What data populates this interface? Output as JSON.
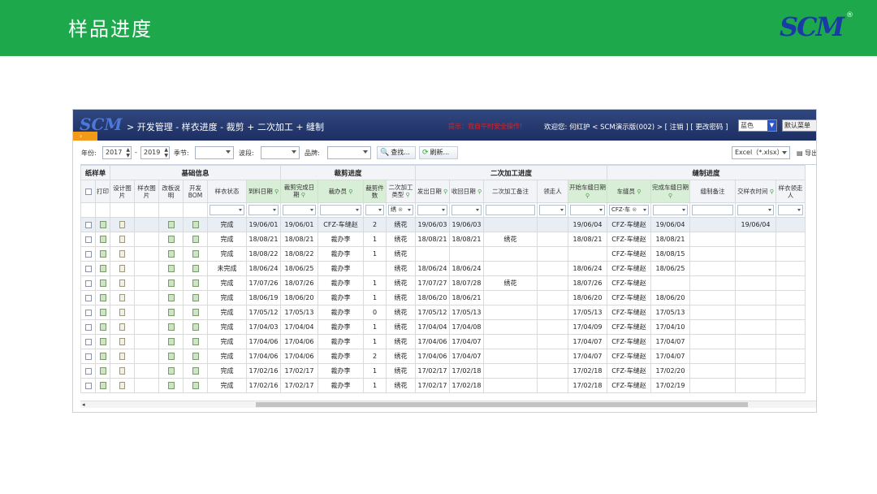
{
  "slide": {
    "title": "样品进度",
    "logo": "SCM"
  },
  "app": {
    "logo": "SCM",
    "breadcrumb": "> 开发管理 - 样衣进度 - 裁剪 + 二次加工 + 缝制",
    "warning": "提示：我自午时安全操作!",
    "user": "欢迎您: 何红护 < SCM演示版(002) > [ 注销 ] [ 更改密码 ]",
    "skin": "蓝色",
    "menu": "默认菜单"
  },
  "toolbar": {
    "year_label": "年份:",
    "year_from": "2017",
    "dash": "-",
    "year_to": "2019",
    "season_label": "季节:",
    "wave_label": "波段:",
    "category_label": "品牌:",
    "find_label": "查找...",
    "refresh_label": "刷新...",
    "excel_label": "Excel（*.xlsx）",
    "export_label": "导出"
  },
  "groups": [
    {
      "label": "纸样单",
      "span": 2
    },
    {
      "label": "基础信息",
      "span": 6
    },
    {
      "label": "裁剪进度",
      "span": 4
    },
    {
      "label": "二次加工进度",
      "span": 5
    },
    {
      "label": "缝制进度",
      "span": 6
    }
  ],
  "columns": [
    "",
    "打印",
    "设计图片",
    "样衣图片",
    "改板说明",
    "开发BOM",
    "样衣状态",
    "到料日期",
    "裁剪完成日期",
    "裁办员",
    "裁剪件数",
    "二次加工类型",
    "发出日期",
    "收回日期",
    "二次加工备注",
    "领走人",
    "开始车缝日期",
    "车缝员",
    "完成车缝日期",
    "缝制备注",
    "交样衣时间",
    "样衣领走人"
  ],
  "filters": {
    "processing_type": "绣",
    "sewer": "CFZ-车"
  },
  "rows": [
    [
      "完成",
      "19/06/01",
      "19/06/01",
      "CFZ-车缝赵",
      "2",
      "绣花",
      "19/06/03",
      "19/06/03",
      "",
      "",
      "19/06/04",
      "CFZ-车缝赵",
      "19/06/04",
      "",
      "19/06/04",
      ""
    ],
    [
      "完成",
      "18/08/21",
      "18/08/21",
      "裁办李",
      "1",
      "绣花",
      "18/08/21",
      "18/08/21",
      "绣花",
      "",
      "18/08/21",
      "CFZ-车缝赵",
      "18/08/21",
      "",
      "",
      ""
    ],
    [
      "完成",
      "18/08/22",
      "18/08/22",
      "裁办李",
      "1",
      "绣花",
      "",
      "",
      "",
      "",
      "",
      "CFZ-车缝赵",
      "18/08/15",
      "",
      "",
      ""
    ],
    [
      "未完成",
      "18/06/24",
      "18/06/25",
      "裁办李",
      "",
      "绣花",
      "18/06/24",
      "18/06/24",
      "",
      "",
      "18/06/24",
      "CFZ-车缝赵",
      "18/06/25",
      "",
      "",
      ""
    ],
    [
      "完成",
      "17/07/26",
      "18/07/26",
      "裁办李",
      "1",
      "绣花",
      "17/07/27",
      "18/07/28",
      "绣花",
      "",
      "18/07/26",
      "CFZ-车缝赵",
      "",
      "",
      "",
      ""
    ],
    [
      "完成",
      "18/06/19",
      "18/06/20",
      "裁办李",
      "1",
      "绣花",
      "18/06/20",
      "18/06/21",
      "",
      "",
      "18/06/20",
      "CFZ-车缝赵",
      "18/06/20",
      "",
      "",
      ""
    ],
    [
      "完成",
      "17/05/12",
      "17/05/13",
      "裁办李",
      "0",
      "绣花",
      "17/05/12",
      "17/05/13",
      "",
      "",
      "17/05/13",
      "CFZ-车缝赵",
      "17/05/13",
      "",
      "",
      ""
    ],
    [
      "完成",
      "17/04/03",
      "17/04/04",
      "裁办李",
      "1",
      "绣花",
      "17/04/04",
      "17/04/08",
      "",
      "",
      "17/04/09",
      "CFZ-车缝赵",
      "17/04/10",
      "",
      "",
      ""
    ],
    [
      "完成",
      "17/04/06",
      "17/04/06",
      "裁办李",
      "1",
      "绣花",
      "17/04/06",
      "17/04/07",
      "",
      "",
      "17/04/07",
      "CFZ-车缝赵",
      "17/04/07",
      "",
      "",
      ""
    ],
    [
      "完成",
      "17/04/06",
      "17/04/06",
      "裁办李",
      "2",
      "绣花",
      "17/04/06",
      "17/04/07",
      "",
      "",
      "17/04/07",
      "CFZ-车缝赵",
      "17/04/07",
      "",
      "",
      ""
    ],
    [
      "完成",
      "17/02/16",
      "17/02/17",
      "裁办李",
      "1",
      "绣花",
      "17/02/17",
      "17/02/18",
      "",
      "",
      "17/02/18",
      "CFZ-车缝赵",
      "17/02/20",
      "",
      "",
      ""
    ],
    [
      "完成",
      "17/02/16",
      "17/02/17",
      "裁办李",
      "1",
      "绣花",
      "17/02/17",
      "17/02/18",
      "",
      "",
      "17/02/18",
      "CFZ-车缝赵",
      "17/02/19",
      "",
      "",
      ""
    ]
  ],
  "colors": {
    "slide_header": "#1ea84c",
    "app_header": "#2a3d73",
    "accent": "#f39a1a"
  }
}
